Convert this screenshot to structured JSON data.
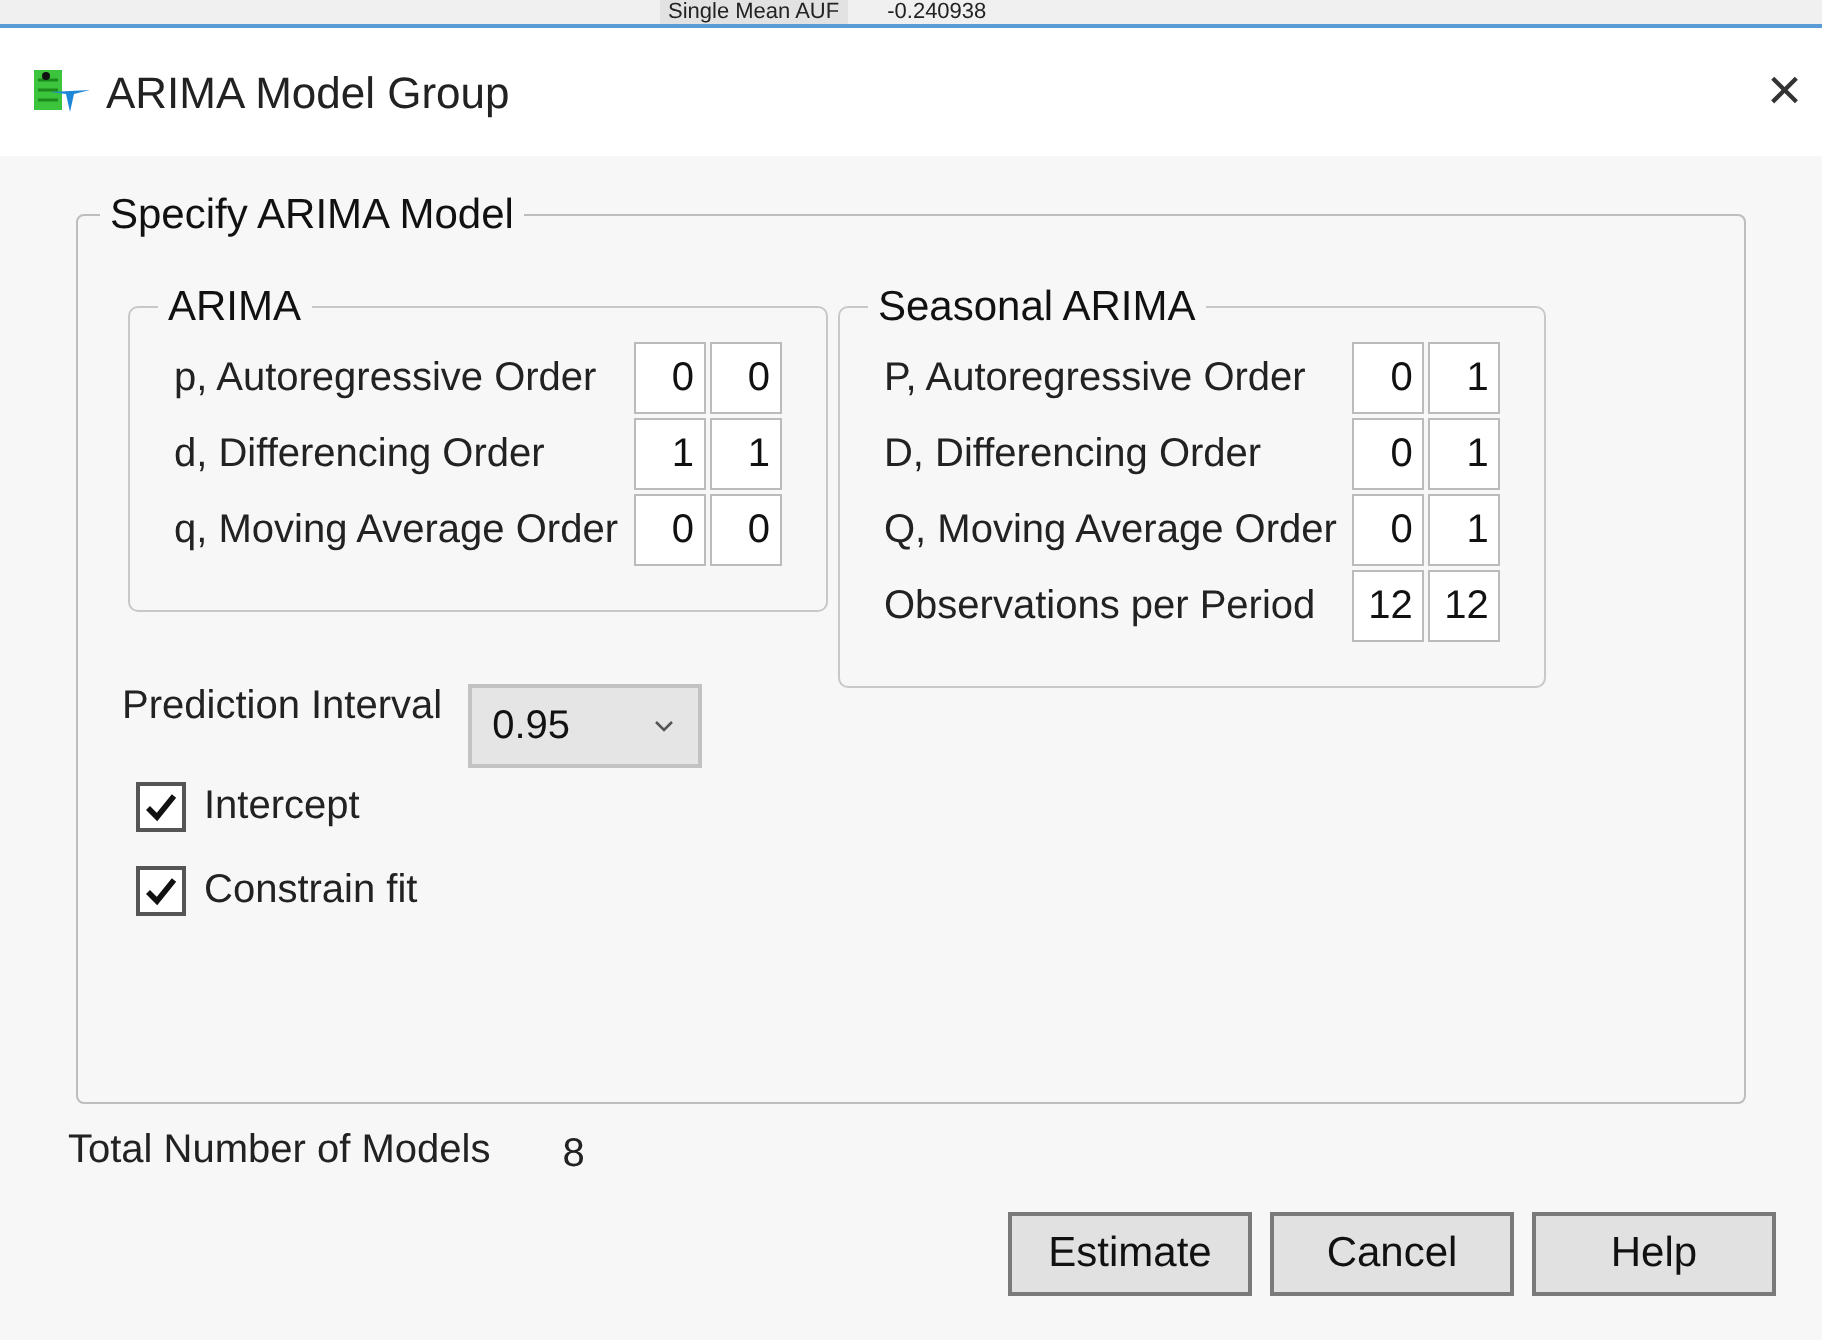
{
  "background_window": {
    "row_label": "Single Mean AUF",
    "row_value": "-0.240938"
  },
  "window": {
    "title": "ARIMA Model Group",
    "close": "×"
  },
  "specify": {
    "title": "Specify ARIMA Model",
    "arima": {
      "title": "ARIMA",
      "rows": [
        {
          "label": "p, Autoregressive Order",
          "values": [
            "0",
            "0"
          ]
        },
        {
          "label": "d, Differencing Order",
          "values": [
            "1",
            "1"
          ]
        },
        {
          "label": "q, Moving Average Order",
          "values": [
            "0",
            "0"
          ]
        }
      ]
    },
    "seasonal": {
      "title": "Seasonal ARIMA",
      "rows": [
        {
          "label": "P, Autoregressive Order",
          "values": [
            "0",
            "1"
          ]
        },
        {
          "label": "D, Differencing Order",
          "values": [
            "0",
            "1"
          ]
        },
        {
          "label": "Q, Moving Average Order",
          "values": [
            "0",
            "1"
          ]
        },
        {
          "label": "Observations per Period",
          "values": [
            "12",
            "12"
          ]
        }
      ]
    },
    "prediction_interval": {
      "label": "Prediction Interval",
      "value": "0.95"
    },
    "options": [
      {
        "label": "Intercept",
        "checked": true
      },
      {
        "label": "Constrain fit",
        "checked": true
      }
    ]
  },
  "total_models": {
    "label": "Total Number of Models",
    "value": "8"
  },
  "buttons": [
    "Estimate",
    "Cancel",
    "Help"
  ]
}
